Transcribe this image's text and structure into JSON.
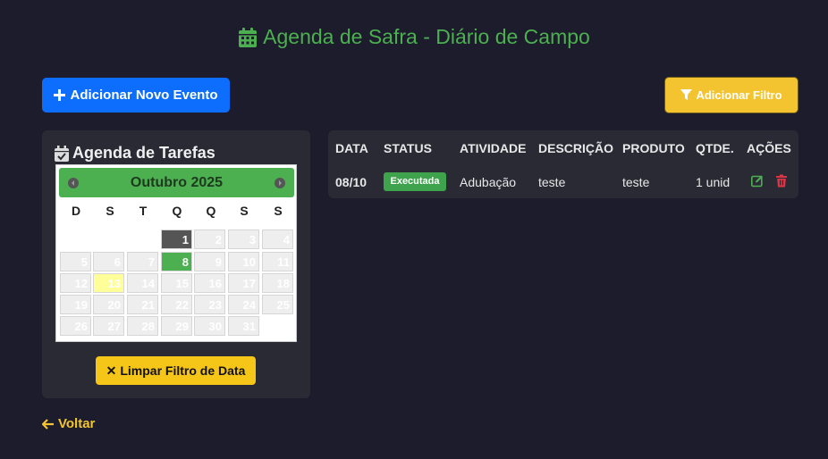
{
  "page": {
    "title": "Agenda de Safra - Diário de Campo"
  },
  "toolbar": {
    "add_label": "Adicionar Novo Evento",
    "filter_label": "Adicionar Filtro"
  },
  "agenda": {
    "title": "Agenda de Tarefas",
    "calendar": {
      "month_label": "Outubro 2025",
      "weekdays": [
        "D",
        "S",
        "T",
        "Q",
        "Q",
        "S",
        "S"
      ],
      "days": [
        "1",
        "2",
        "3",
        "4",
        "5",
        "6",
        "7",
        "8",
        "9",
        "10",
        "11",
        "12",
        "13",
        "14",
        "15",
        "16",
        "17",
        "18",
        "19",
        "20",
        "21",
        "22",
        "23",
        "24",
        "25",
        "26",
        "27",
        "28",
        "29",
        "30",
        "31"
      ]
    },
    "clear_label": "Limpar Filtro de Data"
  },
  "table": {
    "headers": [
      "DATA",
      "STATUS",
      "ATIVIDADE",
      "DESCRIÇÃO",
      "PRODUTO",
      "QTDE.",
      "AÇÕES"
    ],
    "rows": [
      {
        "data": "08/10",
        "status": "Executada",
        "atividade": "Adubação",
        "descricao": "teste",
        "produto": "teste",
        "qtde": "1 unid"
      }
    ]
  },
  "nav": {
    "back_label": "Voltar"
  },
  "colors": {
    "background": "#1c1c2c",
    "accent_green": "#4caf50",
    "primary_blue": "#0d6efd",
    "warning_yellow": "#f4c430",
    "danger_red": "#dc3545"
  }
}
